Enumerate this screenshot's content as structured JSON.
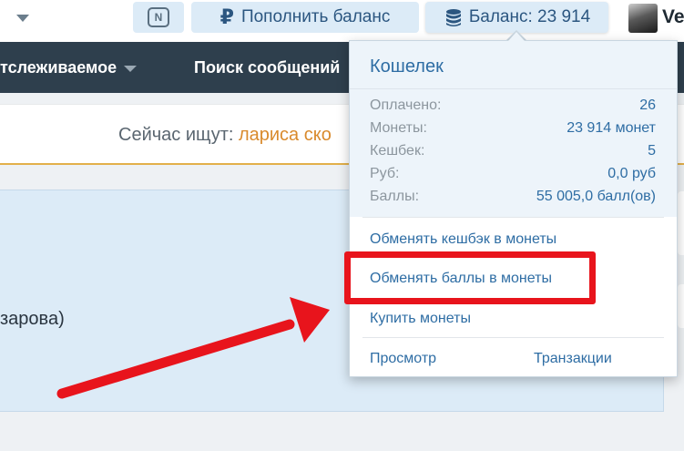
{
  "topbar": {
    "notifications_icon": "n-badge-icon",
    "notifications_letter": "N",
    "topup_label": "Пополнить баланс",
    "balance_label": "Баланс: 23 914",
    "user_name": "Ve"
  },
  "nav": {
    "items": [
      {
        "label": "тслеживаемое",
        "has_caret": true
      },
      {
        "label": "Поиск сообщений"
      }
    ]
  },
  "search": {
    "prefix": "Сейчас ищут: ",
    "query": "лариса ско"
  },
  "content": {
    "text": "зарова)"
  },
  "wallet": {
    "title": "Кошелек",
    "stats": [
      {
        "label": "Оплачено:",
        "value": "26"
      },
      {
        "label": "Монеты:",
        "value": "23 914 монет"
      },
      {
        "label": "Кешбек:",
        "value": "5"
      },
      {
        "label": "Руб:",
        "value": "0,0 руб"
      },
      {
        "label": "Баллы:",
        "value": "55 005,0 балл(ов)"
      }
    ],
    "actions": [
      "Обменять кешбэк в монеты",
      "Обменять баллы в монеты",
      "Купить монеты"
    ],
    "footer": {
      "view": "Просмотр",
      "transactions": "Транзакции"
    }
  },
  "colors": {
    "accent": "#2e6da4",
    "navbar": "#2e3f4d",
    "annotation": "#e8141c",
    "search_query": "#d98a2c"
  }
}
